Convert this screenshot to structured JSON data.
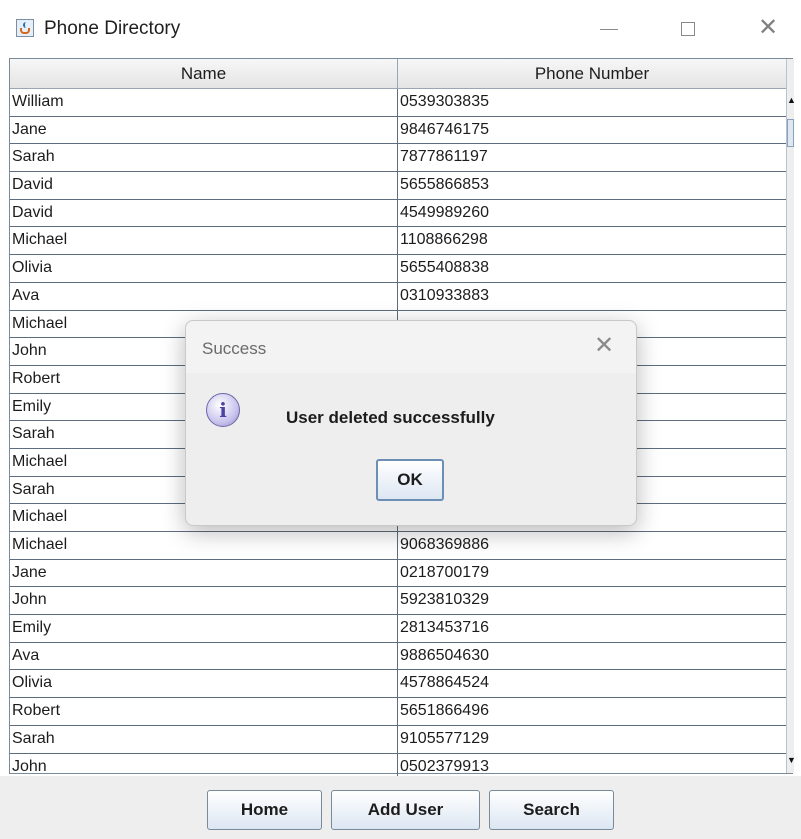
{
  "window": {
    "title": "Phone Directory"
  },
  "table": {
    "headers": {
      "name": "Name",
      "phone": "Phone Number"
    },
    "rows": [
      {
        "name": "William",
        "phone": "0539303835"
      },
      {
        "name": "Jane",
        "phone": "9846746175"
      },
      {
        "name": "Sarah",
        "phone": "7877861197"
      },
      {
        "name": "David",
        "phone": "5655866853"
      },
      {
        "name": "David",
        "phone": "4549989260"
      },
      {
        "name": "Michael",
        "phone": "1108866298"
      },
      {
        "name": "Olivia",
        "phone": "5655408838"
      },
      {
        "name": "Ava",
        "phone": "0310933883"
      },
      {
        "name": "Michael",
        "phone": ""
      },
      {
        "name": "John",
        "phone": ""
      },
      {
        "name": "Robert",
        "phone": ""
      },
      {
        "name": "Emily",
        "phone": ""
      },
      {
        "name": "Sarah",
        "phone": ""
      },
      {
        "name": "Michael",
        "phone": ""
      },
      {
        "name": "Sarah",
        "phone": ""
      },
      {
        "name": "Michael",
        "phone": ""
      },
      {
        "name": "Michael",
        "phone": "9068369886"
      },
      {
        "name": "Jane",
        "phone": "0218700179"
      },
      {
        "name": "John",
        "phone": "5923810329"
      },
      {
        "name": "Emily",
        "phone": "2813453716"
      },
      {
        "name": "Ava",
        "phone": "9886504630"
      },
      {
        "name": "Olivia",
        "phone": "4578864524"
      },
      {
        "name": "Robert",
        "phone": "5651866496"
      },
      {
        "name": "Sarah",
        "phone": "9105577129"
      },
      {
        "name": "John",
        "phone": "0502379913"
      }
    ]
  },
  "buttons": {
    "home": "Home",
    "add_user": "Add User",
    "search": "Search"
  },
  "dialog": {
    "title": "Success",
    "message": "User deleted successfully",
    "ok_label": "OK",
    "icon": "info-icon"
  },
  "icons": {
    "info_glyph": "i"
  }
}
